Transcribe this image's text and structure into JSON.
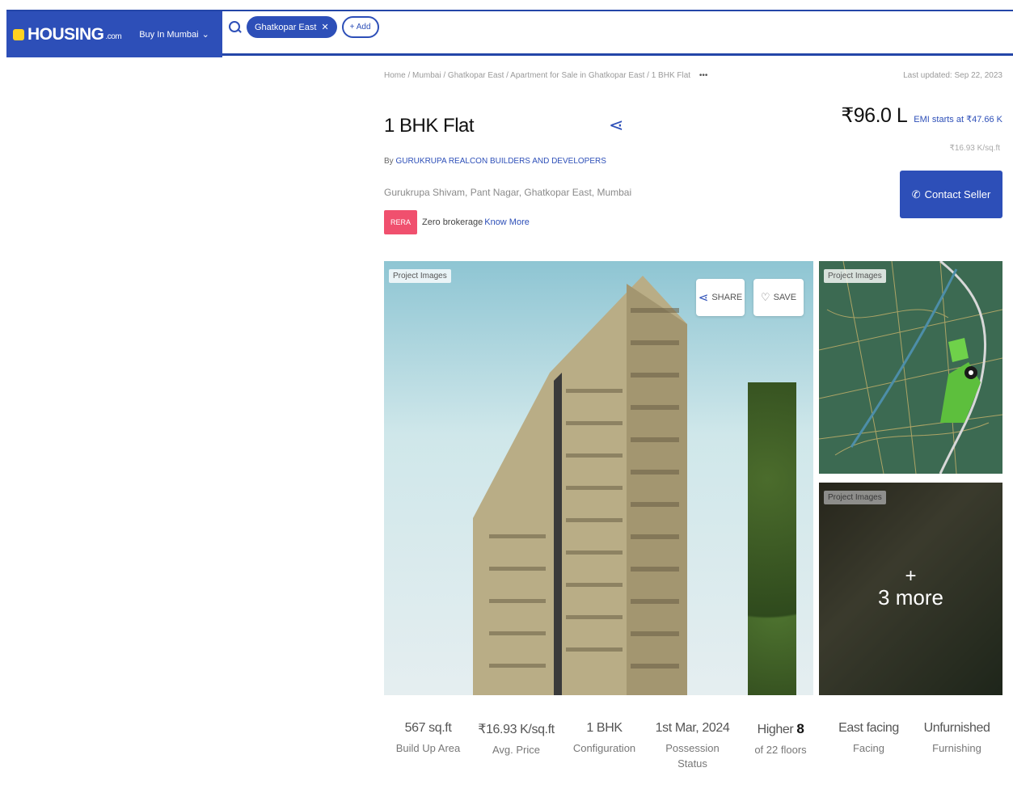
{
  "header": {
    "logo_text": "HOUSING",
    "logo_suffix": ".com",
    "city_select": "Buy In Mumbai",
    "search_chip": "Ghatkopar East",
    "add_chip": "+ Add"
  },
  "breadcrumb": {
    "path": "Home / Mumbai / Ghatkopar East / Apartment for Sale in Ghatkopar East / 1 BHK Flat",
    "more": "•••",
    "last_updated": "Last updated: Sep 22, 2023"
  },
  "listing": {
    "title": "1 BHK Flat",
    "builder_prefix": "By",
    "builder": "GURUKRUPA REALCON BUILDERS AND DEVELOPERS",
    "address": "Gurukrupa Shivam, Pant Nagar, Ghatkopar East, Mumbai",
    "badge": "RERA",
    "zero_brokerage": "Zero brokerage",
    "know_more": "Know More",
    "price": "₹96.0 L",
    "emi": "EMI starts at ₹47.66 K",
    "price_per_sqft": "₹16.93 K/sq.ft",
    "contact_button": "Contact Seller"
  },
  "gallery": {
    "main_tag": "Project Images",
    "share_label": "SHARE",
    "save_label": "SAVE",
    "thumb1_tag": "Project Images",
    "thumb2_tag": "Project Images",
    "more_plus": "+",
    "more_text": "3 more"
  },
  "stats": [
    {
      "value": "567 sq.ft",
      "label": "Build Up Area"
    },
    {
      "value": "₹16.93 K/sq.ft",
      "label": "Avg. Price"
    },
    {
      "value": "1 BHK",
      "label": "Configuration"
    },
    {
      "value": "1st Mar, 2024",
      "label": "Possession Status"
    },
    {
      "value_prefix": "Higher",
      "value_num": "8",
      "label": "of 22 floors"
    },
    {
      "value": "East facing",
      "label": "Facing"
    },
    {
      "value": "Unfurnished",
      "label": "Furnishing"
    }
  ],
  "colors": {
    "brand": "#2d4fb8",
    "badge": "#f0506e"
  }
}
